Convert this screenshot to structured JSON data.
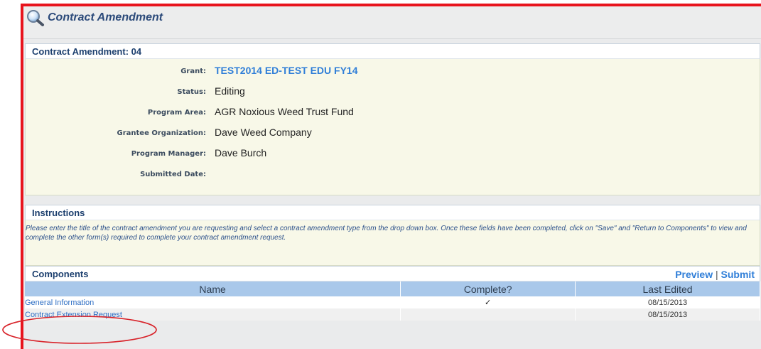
{
  "header": {
    "title": "Contract Amendment",
    "icon": "magnifier-icon"
  },
  "details": {
    "heading": "Contract Amendment: 04",
    "fields": [
      {
        "label": "Grant:",
        "value": "TEST2014 ED-TEST EDU FY14",
        "is_link": true
      },
      {
        "label": "Status:",
        "value": "Editing"
      },
      {
        "label": "Program Area:",
        "value": "AGR Noxious Weed Trust Fund"
      },
      {
        "label": "Grantee Organization:",
        "value": "Dave Weed Company"
      },
      {
        "label": "Program Manager:",
        "value": "Dave Burch"
      },
      {
        "label": "Submitted Date:",
        "value": ""
      }
    ]
  },
  "instructions": {
    "heading": "Instructions",
    "text": "Please enter the title of the contract amendment you are requesting and select a contract amendment type from the drop down box. Once these fields have been completed, click on \"Save\" and \"Return to Components\" to view and complete the other form(s) required to complete your contract amendment request."
  },
  "components": {
    "heading": "Components",
    "preview_label": "Preview",
    "separator": "|",
    "submit_label": "Submit",
    "columns": [
      "Name",
      "Complete?",
      "Last Edited"
    ],
    "rows": [
      {
        "name": "General Information",
        "complete": "✓",
        "last_edited": "08/15/2013"
      },
      {
        "name": "Contract Extension Request",
        "complete": "",
        "last_edited": "08/15/2013"
      }
    ]
  },
  "colors": {
    "annotation_red": "#e8141d",
    "link_blue": "#2f7ed8",
    "table_header": "#a9c8ea",
    "details_bg": "#f8f8e8"
  }
}
